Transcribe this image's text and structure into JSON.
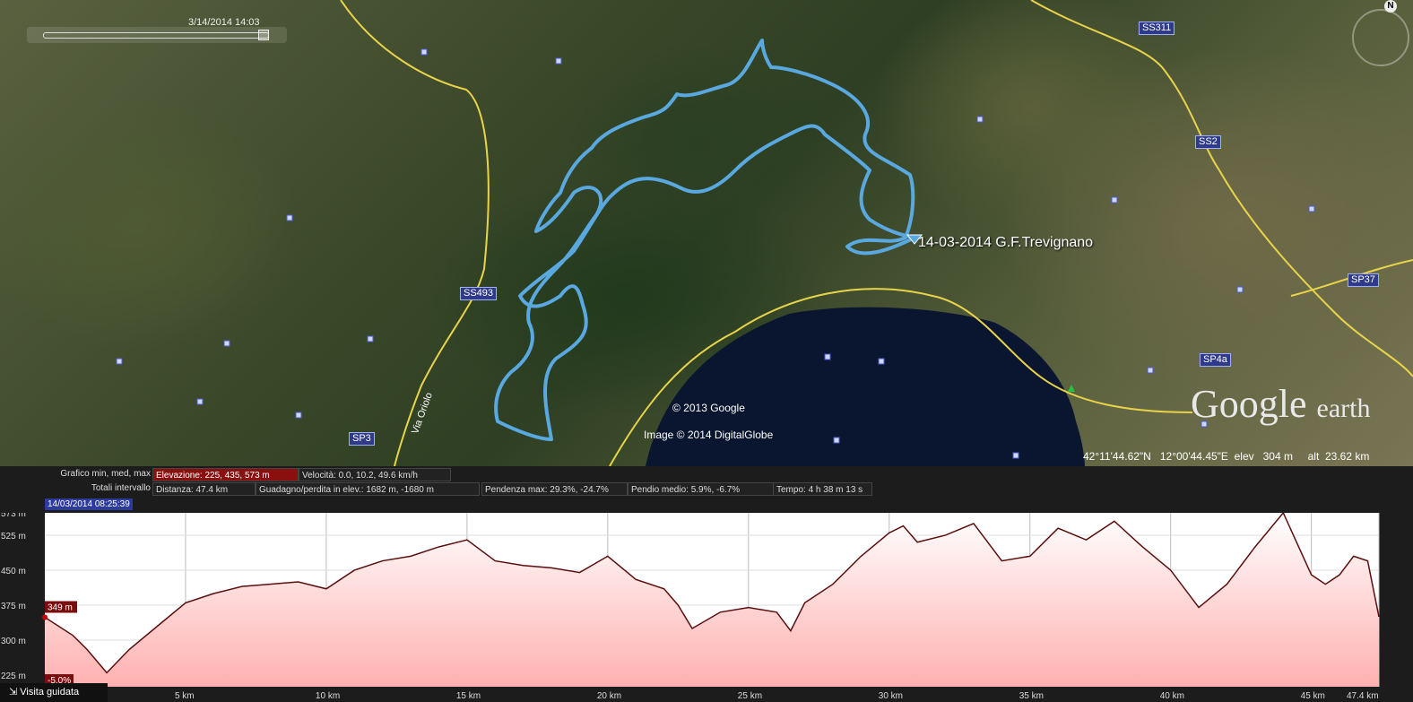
{
  "map": {
    "timestamp": "3/14/2014  14:03",
    "route_label": "14-03-2014 G.F.Trevignano",
    "copyright_google": "© 2013 Google",
    "copyright_imagery": "Image © 2014 DigitalGlobe",
    "logo": "Google",
    "logo_suffix": "earth",
    "status": "42°11'44.62\"N   12°00'44.45\"E  elev   304 m     alt  23.62 km",
    "compass": "N",
    "roads": [
      "SS311",
      "SS2",
      "SS493",
      "SP37",
      "SP4a",
      "SP3"
    ],
    "street_label": "Via Oriolo",
    "route_color": "#5aa8e0",
    "road_color": "#e8d44a"
  },
  "panel": {
    "graph_label": "Grafico  min, med, max",
    "elevation": "Elevazione: 225, 435, 573 m",
    "speed": "Velocità: 0.0, 10.2, 49.6 km/h",
    "totals_label": "Totali intervallo",
    "distance": "Distanza: 47.4 km",
    "gain_loss": "Guadagno/perdita in elev.: 1682 m, -1680 m",
    "max_slope": "Pendenza max: 29.3%, -24.7%",
    "avg_slope": "Pendio medio: 5.9%, -6.7%",
    "time": "Tempo: 4 h 38 m 13 s",
    "date_badge": "14/03/2014 08:25:39",
    "cursor_elev": "349 m",
    "cursor_slope": "-5.0%",
    "tour_button": "Visita guidata",
    "tour_icon": "tour-icon",
    "elevation_color": "#ffb0b0"
  },
  "chart_data": {
    "type": "area",
    "title": "",
    "xlabel": "",
    "ylabel": "",
    "xlim": [
      0,
      47.4
    ],
    "ylim": [
      200,
      573
    ],
    "y_ticks": [
      "573 m",
      "525 m",
      "450 m",
      "375 m",
      "300 m",
      "225 m"
    ],
    "y_tick_values": [
      573,
      525,
      450,
      375,
      300,
      225
    ],
    "x_ticks": [
      "5 km",
      "10 km",
      "15 km",
      "20 km",
      "25 km",
      "30 km",
      "35 km",
      "40 km",
      "45 km",
      "47.4 km"
    ],
    "x_tick_values": [
      5,
      10,
      15,
      20,
      25,
      30,
      35,
      40,
      45,
      47.4
    ],
    "series": [
      {
        "x": [
          0,
          1,
          1.5,
          2.2,
          3,
          4,
          5,
          6,
          7,
          8,
          9,
          10,
          11,
          12,
          13,
          14,
          15,
          16,
          17,
          18,
          19,
          20,
          21,
          22,
          22.5,
          23,
          24,
          25,
          26,
          26.5,
          27,
          28,
          29,
          30,
          30.5,
          31,
          32,
          33,
          34,
          35,
          36,
          37,
          38,
          39,
          40,
          41,
          42,
          43,
          44,
          45,
          45.5,
          46,
          46.5,
          47,
          47.4
        ],
        "y": [
          349,
          310,
          280,
          230,
          280,
          330,
          380,
          400,
          415,
          420,
          425,
          410,
          450,
          470,
          480,
          500,
          515,
          470,
          460,
          455,
          445,
          480,
          430,
          410,
          375,
          325,
          360,
          370,
          360,
          320,
          380,
          420,
          480,
          530,
          545,
          510,
          525,
          550,
          470,
          480,
          540,
          515,
          555,
          500,
          450,
          370,
          420,
          500,
          573,
          440,
          420,
          440,
          480,
          470,
          350
        ]
      }
    ]
  }
}
